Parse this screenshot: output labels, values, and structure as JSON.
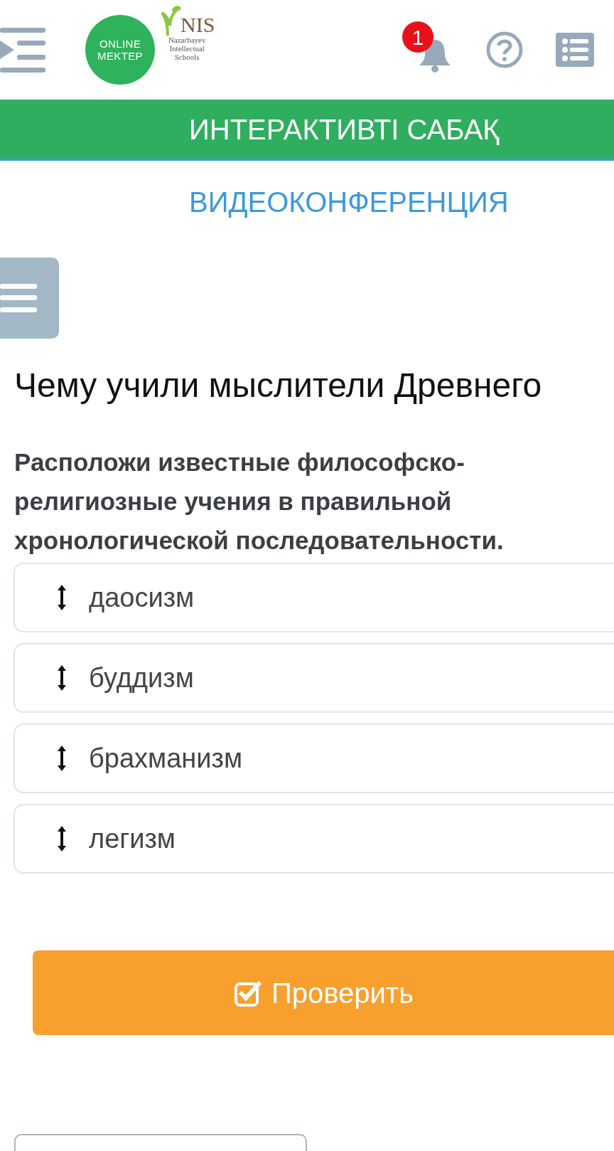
{
  "header": {
    "logo": {
      "line_1": "ONLINE",
      "line_2": "MEKTEP"
    },
    "partner_logo": {
      "mark": "NIS",
      "lines": [
        "Nazarbayev",
        "Intellectual",
        "Schools"
      ]
    },
    "notification_count": "1"
  },
  "tabs": [
    {
      "label": "ИНТЕРАКТИВТІ САБАҚ",
      "selected": true
    },
    {
      "label": "ВИДЕОКОНФЕРЕНЦИЯ",
      "selected": false
    }
  ],
  "lesson_title": "Чему учили мыслители Древнего",
  "task": {
    "instruction": "Расположи известные философско-религиозные учения в правильной хронологической последовательности.",
    "items": [
      {
        "label": "даосизм"
      },
      {
        "label": "буддизм"
      },
      {
        "label": "брахманизм"
      },
      {
        "label": "легизм"
      }
    ]
  },
  "check_button": "Проверить"
}
